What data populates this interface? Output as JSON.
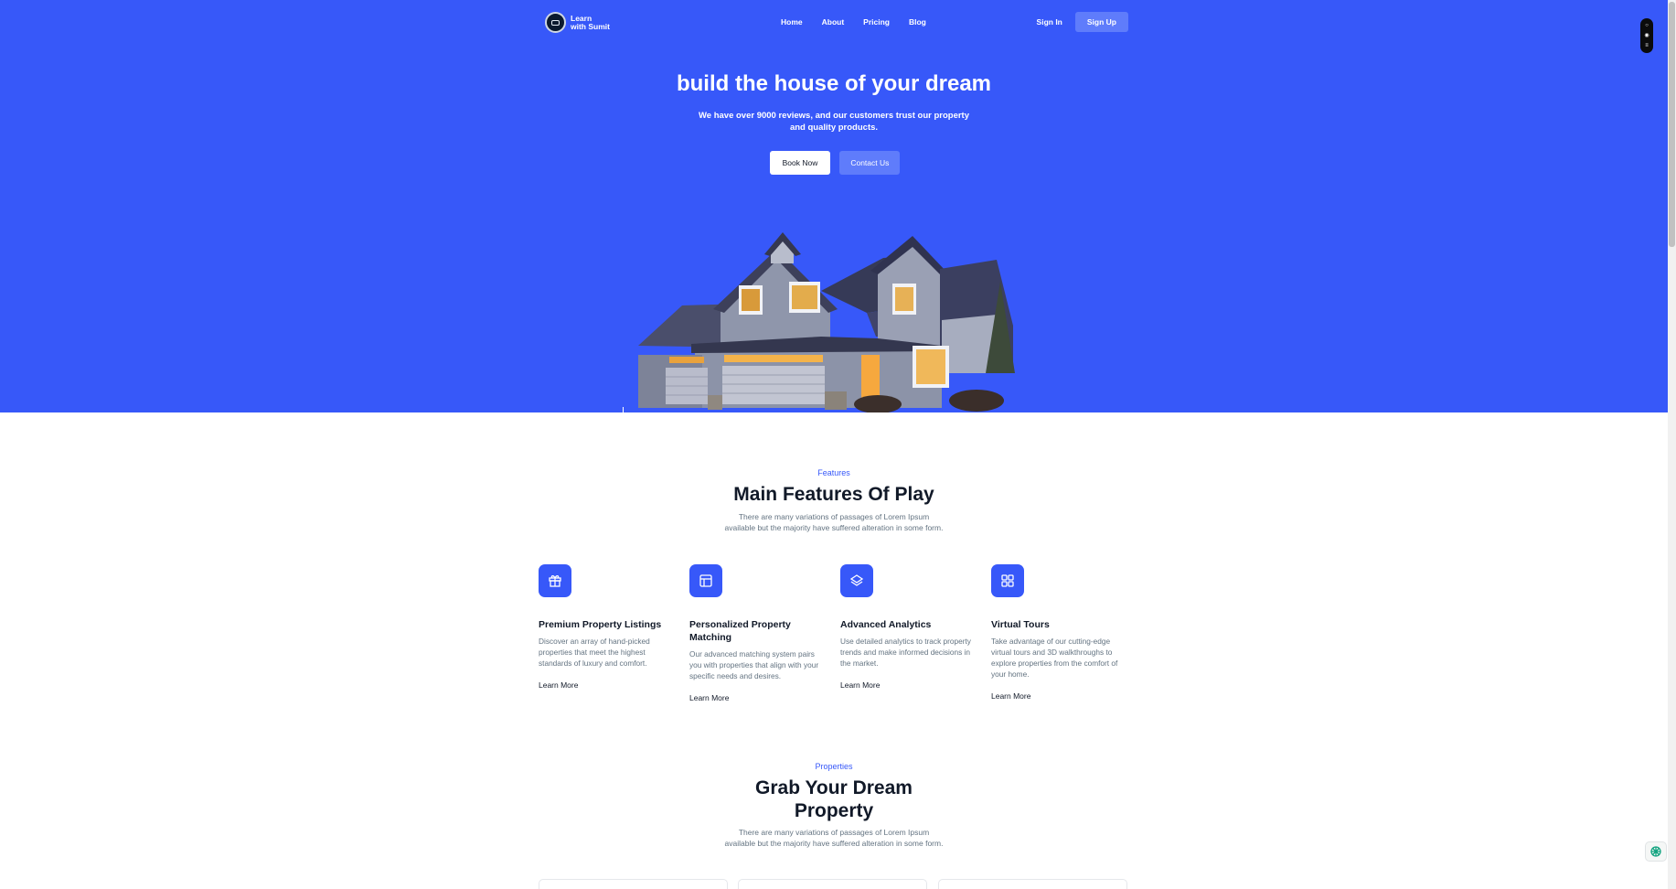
{
  "nav": {
    "logo_line1": "Learn",
    "logo_line2": "with Sumit",
    "items": [
      "Home",
      "About",
      "Pricing",
      "Blog"
    ],
    "sign_in": "Sign In",
    "sign_up": "Sign Up"
  },
  "hero": {
    "title": "build the house of your dream",
    "subtitle_line1": "We have over 9000 reviews, and our customers trust our property",
    "subtitle_line2": "and quality products.",
    "book_now": "Book Now",
    "contact_us": "Contact Us"
  },
  "features": {
    "tag": "Features",
    "title": "Main Features Of Play",
    "desc_line1": "There are many variations of passages of Lorem Ipsum",
    "desc_line2": "available but the majority have suffered alteration in some form.",
    "items": [
      {
        "icon": "gift-icon",
        "title": "Premium Property Listings",
        "desc": "Discover an array of hand-picked properties that meet the highest standards of luxury and comfort.",
        "link": "Learn More"
      },
      {
        "icon": "layout-icon",
        "title": "Personalized Property Matching",
        "desc": "Our advanced matching system pairs you with properties that align with your specific needs and desires.",
        "link": "Learn More"
      },
      {
        "icon": "layers-icon",
        "title": "Advanced Analytics",
        "desc": "Use detailed analytics to track property trends and make informed decisions in the market.",
        "link": "Learn More"
      },
      {
        "icon": "grid-icon",
        "title": "Virtual Tours",
        "desc": "Take advantage of our cutting-edge virtual tours and 3D walkthroughs to explore properties from the comfort of your home.",
        "link": "Learn More"
      }
    ]
  },
  "properties": {
    "tag": "Properties",
    "title_line1": "Grab Your Dream",
    "title_line2": "Property",
    "desc_line1": "There are many variations of passages of Lorem Ipsum",
    "desc_line2": "available but the majority have suffered alteration in some form."
  },
  "colors": {
    "primary": "#3758f9",
    "heading": "#111928",
    "body": "#637381"
  }
}
